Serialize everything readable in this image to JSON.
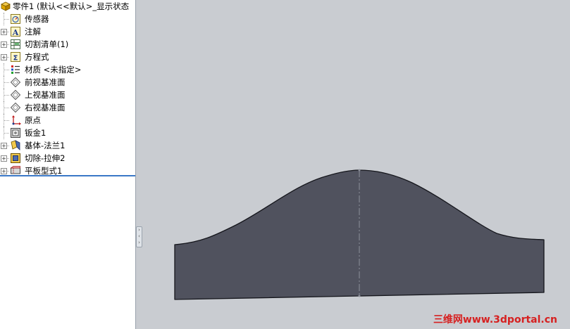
{
  "tree": {
    "root_label": "零件1  (默认<<默认>_显示状态",
    "items": [
      {
        "label": "传感器",
        "icon": "sensor-icon",
        "expandable": false
      },
      {
        "label": "注解",
        "icon": "annotation-icon",
        "expandable": true
      },
      {
        "label": "切割清单(1)",
        "icon": "cut-list-icon",
        "expandable": true
      },
      {
        "label": "方程式",
        "icon": "equation-icon",
        "expandable": true
      },
      {
        "label": "材质 <未指定>",
        "icon": "material-icon",
        "expandable": false
      },
      {
        "label": "前视基准面",
        "icon": "plane-icon",
        "expandable": false
      },
      {
        "label": "上视基准面",
        "icon": "plane-icon",
        "expandable": false
      },
      {
        "label": "右视基准面",
        "icon": "plane-icon",
        "expandable": false
      },
      {
        "label": "原点",
        "icon": "origin-icon",
        "expandable": false
      },
      {
        "label": "钣金1",
        "icon": "sheet-metal-icon",
        "expandable": false
      },
      {
        "label": "基体-法兰1",
        "icon": "base-flange-icon",
        "expandable": true
      },
      {
        "label": "切除-拉伸2",
        "icon": "cut-extrude-icon",
        "expandable": true
      },
      {
        "label": "平板型式1",
        "icon": "flat-pattern-icon",
        "expandable": true
      }
    ]
  },
  "watermark": "三维网www.3dportal.cn",
  "colors": {
    "viewport": "#c9ccd1",
    "part_fill": "#50525e",
    "selection_line": "#3a78c7",
    "watermark": "#d62020"
  }
}
